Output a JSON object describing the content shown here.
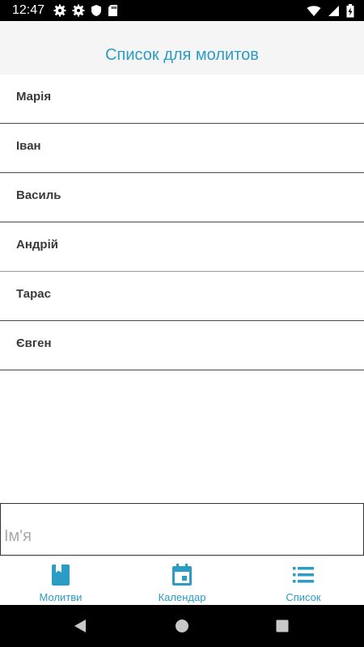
{
  "status_bar": {
    "time": "12:47",
    "left_icons": [
      "gear-icon",
      "gear-icon",
      "shield-icon",
      "sd-card-icon"
    ],
    "right_icons": [
      "wifi-icon",
      "cellular-signal-icon",
      "battery-charging-icon"
    ]
  },
  "header": {
    "title": "Список для молитов"
  },
  "names": [
    {
      "label": "Марія"
    },
    {
      "label": "Іван"
    },
    {
      "label": "Василь"
    },
    {
      "label": "Андрій"
    },
    {
      "label": "Тарас"
    },
    {
      "label": "Євген"
    }
  ],
  "input": {
    "placeholder": "Ім'я",
    "value": ""
  },
  "bottom_nav": {
    "items": [
      {
        "label": "Молитви",
        "icon": "bookmark-book-icon"
      },
      {
        "label": "Календар",
        "icon": "calendar-icon"
      },
      {
        "label": "Список",
        "icon": "list-icon"
      }
    ]
  },
  "colors": {
    "accent": "#2b9cc4",
    "header_bg": "#f5f5f5",
    "text": "#3a3a3a"
  }
}
